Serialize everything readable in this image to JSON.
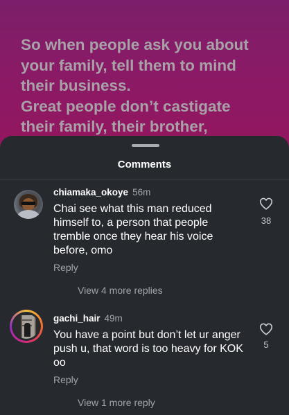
{
  "background": {
    "caption": "So when people ask you about\nyour family, tell them to mind\ntheir business.\nGreat people don’t castigate\ntheir family, their brother,"
  },
  "sheet": {
    "title": "Comments"
  },
  "comments": [
    {
      "username": "chiamaka_okoye",
      "time": "56m",
      "text": "Chai see what this man reduced himself to, a person that people tremble once they hear his voice before, omo",
      "reply_label": "Reply",
      "more_replies": "View 4 more replies",
      "likes": "38"
    },
    {
      "username": "gachi_hair",
      "time": "49m",
      "text": "You have a point but don’t let ur anger push u, that word is too heavy for KOK oo",
      "reply_label": "Reply",
      "more_replies": "View 1 more reply",
      "likes": "5"
    }
  ],
  "colors": {
    "sheet_bg": "#262a2f",
    "muted_text": "#a0a6ae",
    "story_ring": "#d62976"
  },
  "icons": {
    "like": "heart-outline-icon"
  }
}
